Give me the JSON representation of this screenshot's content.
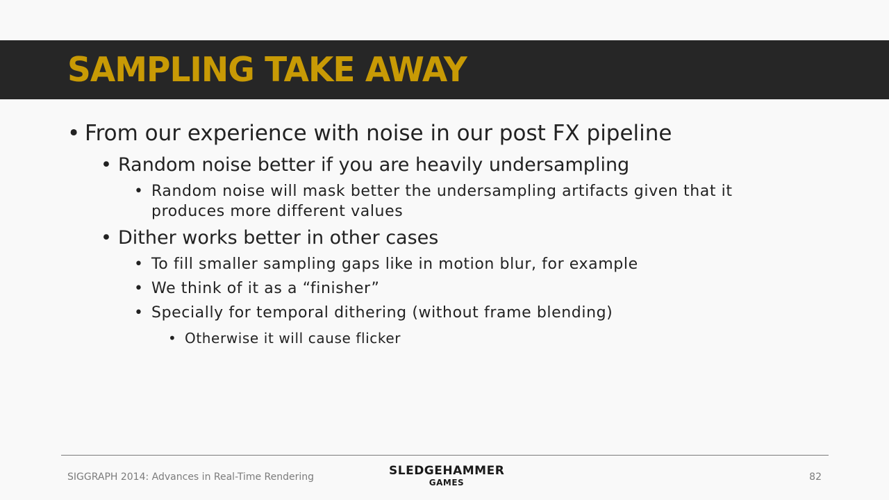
{
  "slide": {
    "title": "SAMPLING TAKE AWAY",
    "bullets": {
      "b1": "From our experience with noise in our post FX pipeline",
      "b1_1": "Random noise better if you are heavily undersampling",
      "b1_1_1_line1": "Random noise will mask better the undersampling artifacts given that it",
      "b1_1_1_line2": "produces more different values",
      "b1_2": "Dither works better in other cases",
      "b1_2_1": "To fill smaller sampling gaps like in motion blur, for example",
      "b1_2_2": "We think of it as a “finisher”",
      "b1_2_3": "Specially for temporal dithering (without frame blending)",
      "b1_2_3_1": "Otherwise it will cause flicker"
    },
    "bullet_char": "•"
  },
  "footer": {
    "conference": "SIGGRAPH 2014: Advances in Real-Time Rendering",
    "logo_top": "SLEDGEHAMMER",
    "logo_bottom": "GAMES",
    "page_number": "82"
  },
  "colors": {
    "title_bar": "#262626",
    "title_text": "#c89a05",
    "background": "#f9f9f9"
  }
}
